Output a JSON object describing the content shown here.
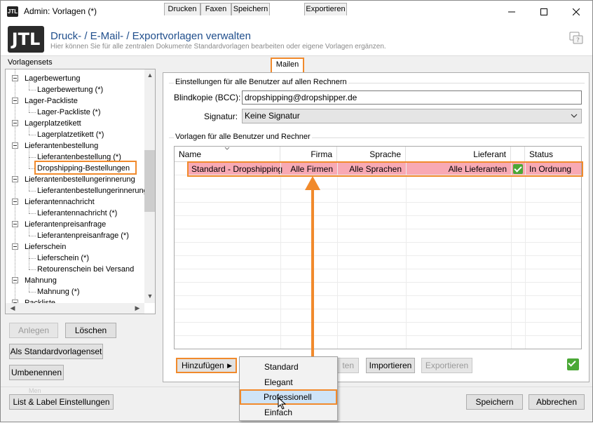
{
  "window": {
    "title": "Admin: Vorlagen (*)",
    "app_icon": "JTL"
  },
  "header": {
    "logo": "JTL",
    "title": "Druck- / E-Mail- / Exportvorlagen verwalten",
    "subtitle": "Hier können Sie für alle zentralen Dokumente Standardvorlagen bearbeiten oder eigene Vorlagen ergänzen."
  },
  "left_panel": {
    "label": "Vorlagensets",
    "tree": [
      {
        "label": "Lagerbewertung",
        "level": 0
      },
      {
        "label": "Lagerbewertung (*)",
        "level": 1
      },
      {
        "label": "Lager-Packliste",
        "level": 0
      },
      {
        "label": "Lager-Packliste (*)",
        "level": 1
      },
      {
        "label": "Lagerplatzetikett",
        "level": 0
      },
      {
        "label": "Lagerplatzetikett (*)",
        "level": 1
      },
      {
        "label": "Lieferantenbestellung",
        "level": 0
      },
      {
        "label": "Lieferantenbestellung (*)",
        "level": 1
      },
      {
        "label": "Dropshipping-Bestellungen",
        "level": 1
      },
      {
        "label": "Lieferantenbestellungerinnerung",
        "level": 0
      },
      {
        "label": "Lieferantenbestellungerinnerung",
        "level": 1
      },
      {
        "label": "Lieferantennachricht",
        "level": 0
      },
      {
        "label": "Lieferantennachricht (*)",
        "level": 1
      },
      {
        "label": "Lieferantenpreisanfrage",
        "level": 0
      },
      {
        "label": "Lieferantenpreisanfrage (*)",
        "level": 1
      },
      {
        "label": "Lieferschein",
        "level": 0
      },
      {
        "label": "Lieferschein (*)",
        "level": 1
      },
      {
        "label": "Retourenschein bei Versand",
        "level": 1
      },
      {
        "label": "Mahnung",
        "level": 0
      },
      {
        "label": "Mahnung (*)",
        "level": 1
      },
      {
        "label": "Packliste",
        "level": 0
      }
    ],
    "buttons": {
      "anlegen": "Anlegen",
      "loeschen": "Löschen",
      "standard": "Als Standardvorlagenset",
      "umbenennen": "Umbenennen"
    }
  },
  "tabs": [
    "Drucken",
    "Faxen",
    "Speichern",
    "Mailen",
    "Exportieren"
  ],
  "settings_group": {
    "title": "Einstellungen für alle Benutzer auf allen Rechnern",
    "bcc_label": "Blindkopie (BCC):",
    "bcc_value": "dropshipping@dropshipper.de",
    "signature_label": "Signatur:",
    "signature_value": "Keine Signatur"
  },
  "templates_group": {
    "title": "Vorlagen für alle Benutzer und Rechner",
    "columns": [
      "Name",
      "Firma",
      "Sprache",
      "Lieferant",
      "Status"
    ],
    "rows": [
      {
        "name": "Standard - Dropshipping",
        "firma": "Alle Firmen",
        "sprache": "Alle Sprachen",
        "lieferant": "Alle Lieferanten",
        "status": "In Ordnung"
      }
    ],
    "buttons": {
      "hinzufuegen": "Hinzufügen",
      "bearbeiten_partial": "ten",
      "importieren": "Importieren",
      "exportieren": "Exportieren"
    }
  },
  "menu": {
    "items": [
      "Standard",
      "Elegant",
      "Professionell",
      "Einfach"
    ],
    "hovered": "Professionell"
  },
  "bottom": {
    "list_label": "List & Label Einstellungen",
    "speichern": "Speichern",
    "abbrechen": "Abbrechen",
    "hidden_fragment": "Men"
  },
  "colors": {
    "accent_orange": "#f18a2c",
    "row_highlight": "#f8a9b4",
    "title_blue": "#1f4e8c",
    "status_green": "#4aa836"
  }
}
